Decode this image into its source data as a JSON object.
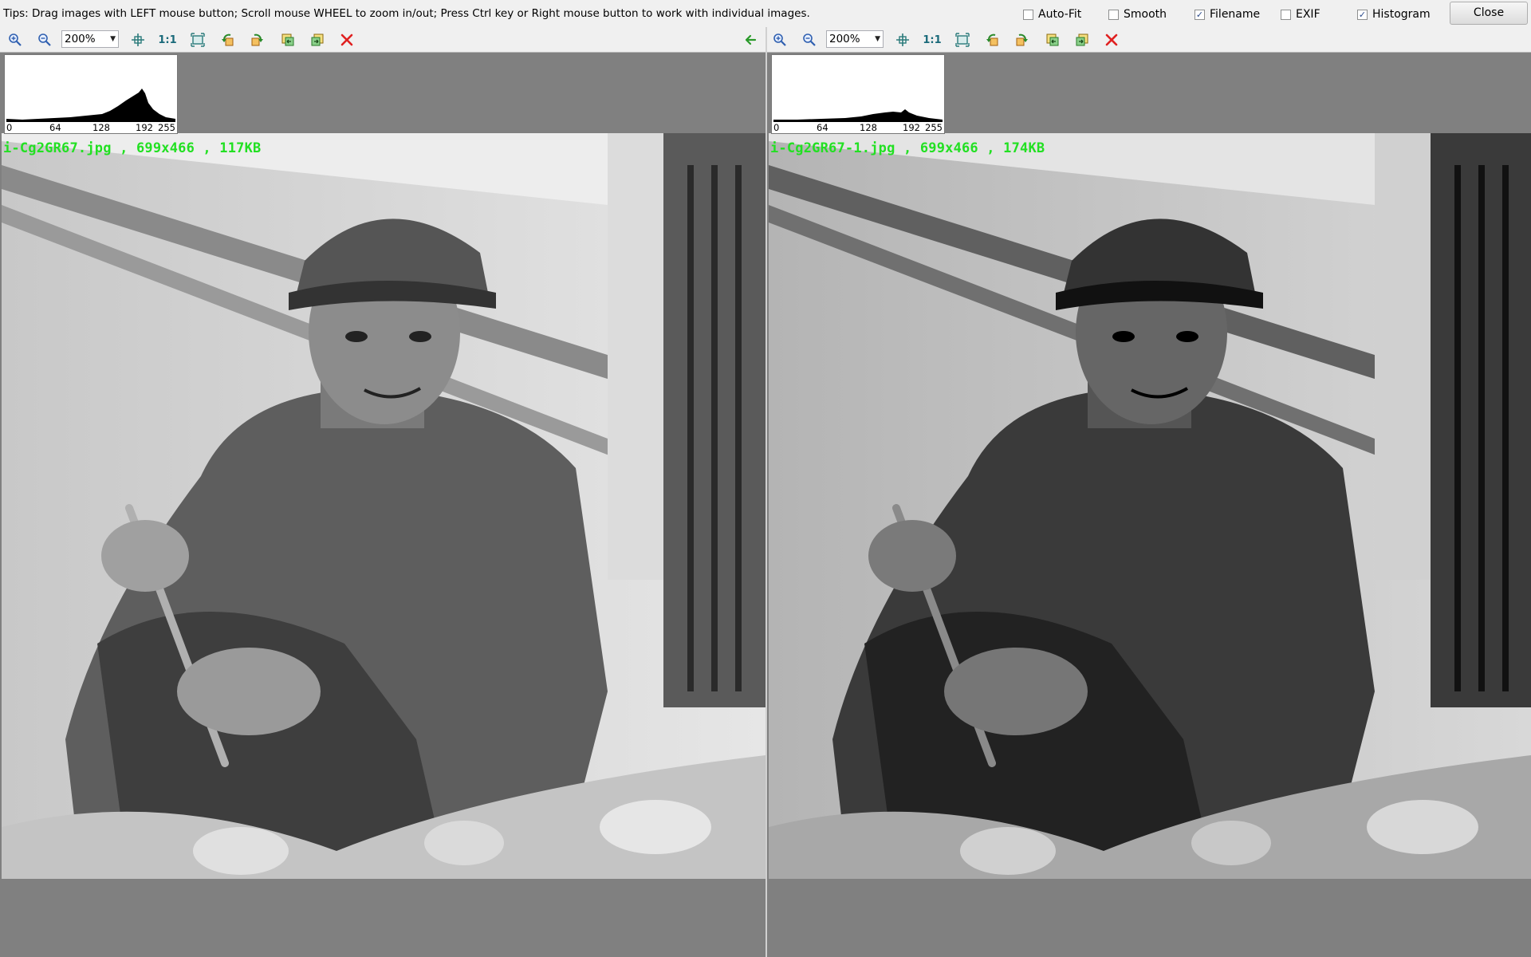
{
  "tips": "Tips: Drag images with LEFT mouse button; Scroll mouse WHEEL to zoom in/out; Press Ctrl key or Right mouse button to work with individual images.",
  "options": [
    {
      "label": "Auto-Fit",
      "checked": false
    },
    {
      "label": "Smooth",
      "checked": false
    },
    {
      "label": "Filename",
      "checked": true
    },
    {
      "label": "EXIF",
      "checked": false
    },
    {
      "label": "Histogram",
      "checked": true
    }
  ],
  "close_label": "Close",
  "panels": {
    "left": {
      "zoom": "200%",
      "one_to_one": "1:1",
      "filename_overlay": "i-Cg2GR67.jpg , 699x466 , 117KB",
      "histogram_ticks": [
        "0",
        "64",
        "128",
        "192",
        "255"
      ]
    },
    "right": {
      "zoom": "200%",
      "one_to_one": "1:1",
      "filename_overlay": "i-Cg2GR67-1.jpg , 699x466 , 174KB",
      "histogram_ticks": [
        "0",
        "64",
        "128",
        "192",
        "255"
      ]
    }
  },
  "toolbar_icons": [
    "zoom-in-icon",
    "zoom-out-icon",
    "fit-icon",
    "actual-size-icon",
    "fullscreen-icon",
    "rotate-left-icon",
    "rotate-right-icon",
    "copy-left-icon",
    "copy-right-icon",
    "remove-icon"
  ],
  "colors": {
    "overlay_text": "#22e022",
    "background": "#808080",
    "remove_icon": "#e02020"
  }
}
